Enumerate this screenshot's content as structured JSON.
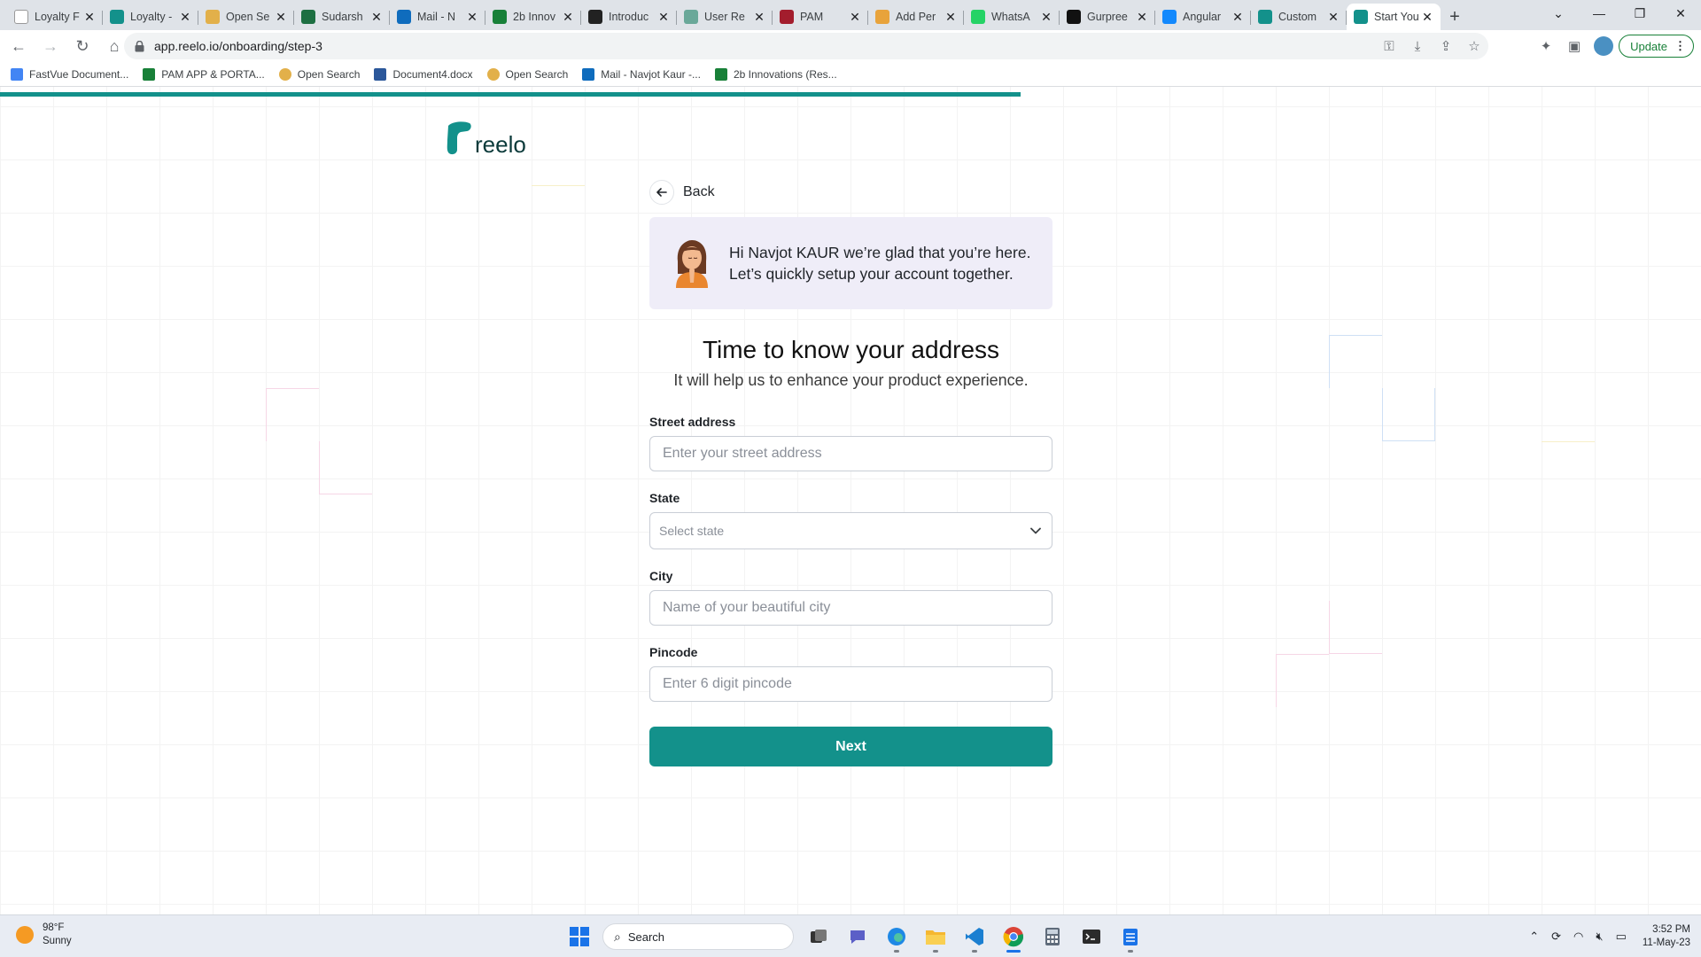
{
  "browser": {
    "tabs": [
      {
        "title": "Loyalty F",
        "favicon": "zb-icon",
        "color": "#ffffff"
      },
      {
        "title": "Loyalty -",
        "favicon": "reelo-icon",
        "color": "#13918b"
      },
      {
        "title": "Open Se",
        "favicon": "opensearch-icon",
        "color": "#e2b04a"
      },
      {
        "title": "Sudarsh",
        "favicon": "excel-icon",
        "color": "#1d6f42"
      },
      {
        "title": "Mail - N",
        "favicon": "outlook-icon",
        "color": "#0f6cbd"
      },
      {
        "title": "2b Innov",
        "favicon": "sheets-icon",
        "color": "#188038"
      },
      {
        "title": "Introduc",
        "favicon": "openai-icon",
        "color": "#222222"
      },
      {
        "title": "User Re",
        "favicon": "chatgpt-icon",
        "color": "#6aa899"
      },
      {
        "title": "PAM",
        "favicon": "pam-icon",
        "color": "#a31d2d"
      },
      {
        "title": "Add Per",
        "favicon": "p-icon",
        "color": "#e8a33b"
      },
      {
        "title": "WhatsA",
        "favicon": "whatsapp-icon",
        "color": "#25d366"
      },
      {
        "title": "Gurpree",
        "favicon": "github-icon",
        "color": "#111111"
      },
      {
        "title": "Angular",
        "favicon": "stackblitz-icon",
        "color": "#1389fd"
      },
      {
        "title": "Custom",
        "favicon": "reelo-icon",
        "color": "#13918b"
      },
      {
        "title": "Start You",
        "favicon": "reelo-icon",
        "color": "#13918b",
        "active": true
      }
    ],
    "url": "app.reelo.io/onboarding/step-3",
    "update_label": "Update",
    "bookmarks": [
      {
        "label": "FastVue Document...",
        "icon": "google-icon",
        "color": "#4285f4"
      },
      {
        "label": "PAM APP & PORTA...",
        "icon": "sheets-icon",
        "color": "#188038"
      },
      {
        "label": "Open Search",
        "icon": "opensearch-icon",
        "color": "#e2b04a"
      },
      {
        "label": "Document4.docx",
        "icon": "word-icon",
        "color": "#2b579a"
      },
      {
        "label": "Open Search",
        "icon": "opensearch-icon",
        "color": "#e2b04a"
      },
      {
        "label": "Mail - Navjot Kaur -...",
        "icon": "outlook-icon",
        "color": "#0f6cbd"
      },
      {
        "label": "2b Innovations (Res...",
        "icon": "sheets-icon",
        "color": "#188038"
      }
    ]
  },
  "page": {
    "progress_fraction": 0.6,
    "accent": "#13918b",
    "logo_text": "reelo",
    "back_label": "Back",
    "greeting": "Hi Navjot KAUR we’re glad that you’re here. Let’s quickly setup your account together.",
    "heading": "Time to know your address",
    "subheading": "It will help us to enhance your product experience.",
    "fields": {
      "street": {
        "label": "Street address",
        "placeholder": "Enter your street address",
        "value": ""
      },
      "state": {
        "label": "State",
        "placeholder": "Select state"
      },
      "city": {
        "label": "City",
        "placeholder": "Name of your beautiful city",
        "value": ""
      },
      "pincode": {
        "label": "Pincode",
        "placeholder": "Enter 6 digit pincode",
        "value": ""
      }
    },
    "next_label": "Next"
  },
  "taskbar": {
    "weather_temp": "98°F",
    "weather_desc": "Sunny",
    "search_label": "Search",
    "time": "3:52 PM",
    "date": "11-May-23"
  }
}
